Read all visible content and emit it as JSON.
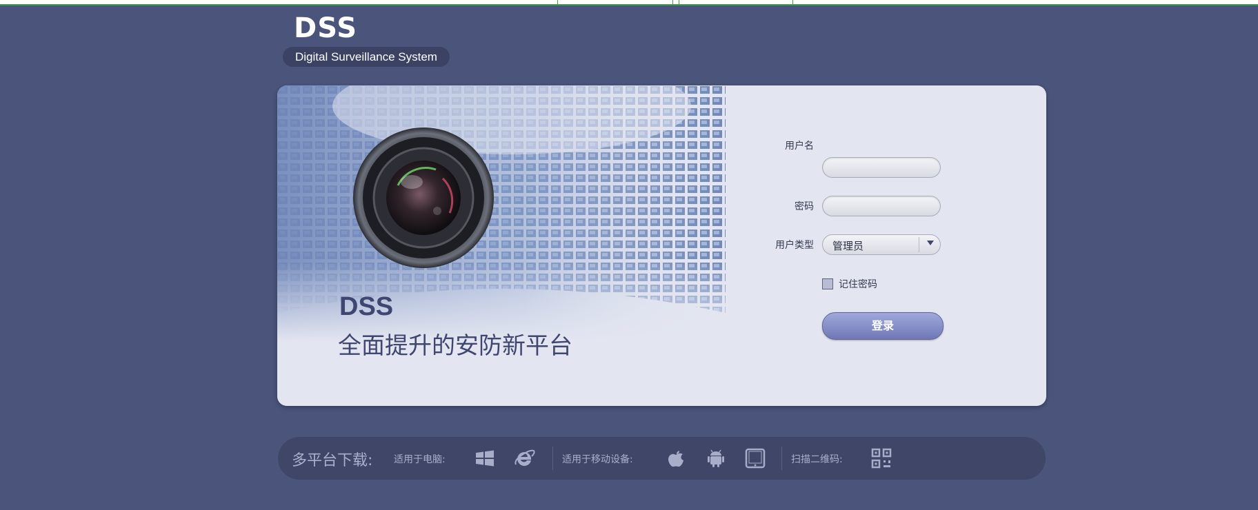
{
  "brand": {
    "logo": "DSS",
    "subtitle": "Digital Surveillance System"
  },
  "hero": {
    "title": "DSS",
    "slogan": "全面提升的安防新平台"
  },
  "login": {
    "username_label": "用户名",
    "username_value": "",
    "password_label": "密码",
    "password_value": "",
    "usertype_label": "用户类型",
    "usertype_selected": "管理员",
    "remember_label": "记住密码",
    "remember_checked": false,
    "submit_label": "登录"
  },
  "downloads": {
    "title": "多平台下载:",
    "pc_label": "适用于电脑:",
    "mobile_label": "适用于移动设备:",
    "qr_label": "扫描二维码:",
    "icons": [
      "windows-icon",
      "ie-icon",
      "apple-icon",
      "android-icon",
      "tablet-icon",
      "qr-code-icon"
    ]
  },
  "colors": {
    "background": "#4b547a",
    "card": "#e3e6f1",
    "accent": "#7a83c2",
    "text_dark": "#3f4770"
  }
}
